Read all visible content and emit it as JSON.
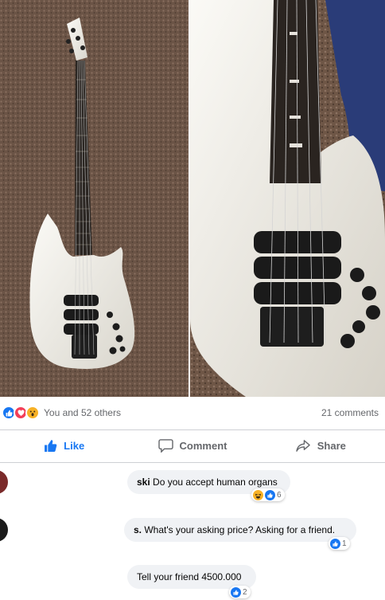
{
  "post": {
    "reactions": {
      "summary": "You and 52 others",
      "icons": [
        "like-icon",
        "love-icon",
        "wow-icon"
      ]
    },
    "comments_count": "21 comments",
    "actions": {
      "like": "Like",
      "comment": "Comment",
      "share": "Share"
    }
  },
  "comments": [
    {
      "author_fragment": "ski",
      "text": "Do you accept human organs",
      "reaction_count": "6",
      "reaction_icons": [
        "haha-icon",
        "like-icon"
      ]
    },
    {
      "author_fragment": "s.",
      "text": "What's your asking price? Asking for a friend.",
      "reaction_count": "1",
      "reaction_icons": [
        "like-icon"
      ]
    },
    {
      "text": "Tell your friend 4500.000",
      "reaction_count": "2",
      "reaction_icons": [
        "like-icon"
      ]
    }
  ],
  "colors": {
    "accent": "#1877f2",
    "muted": "#65676b",
    "bubble": "#f0f2f5",
    "divider": "#ced0d4",
    "bass_body": "#f1efe9",
    "carpet": "#6e5748",
    "wall": "#2a3c78"
  }
}
